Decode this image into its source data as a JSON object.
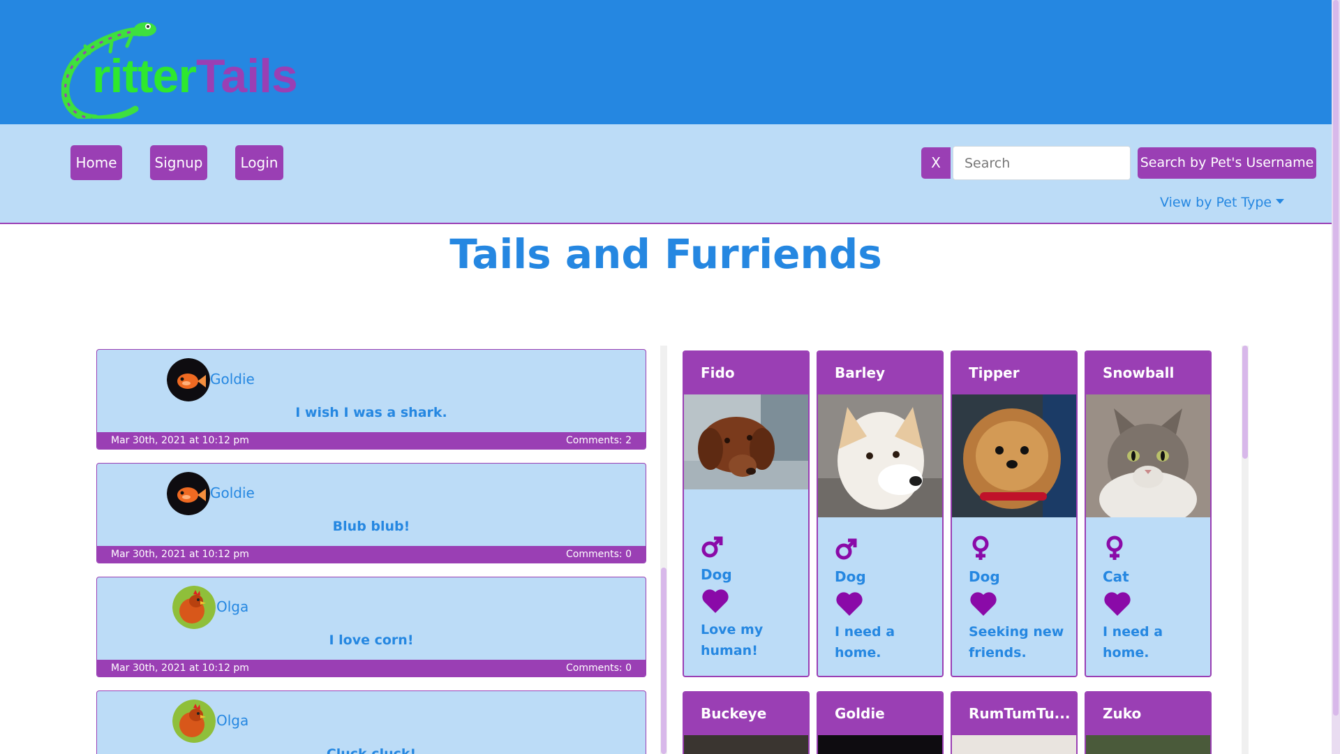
{
  "logo": {
    "part1": "ritter",
    "part2": "Tails"
  },
  "nav": {
    "home": "Home",
    "signup": "Signup",
    "login": "Login",
    "clear": "X",
    "search_placeholder": "Search",
    "search_button": "Search by Pet's Username",
    "pet_type": "View by Pet Type"
  },
  "main": {
    "title": "Tails and Furriends"
  },
  "posts": [
    {
      "author": "Goldie",
      "message": "I wish I was a shark.",
      "date": "Mar 30th, 2021 at 10:12 pm",
      "comments": "Comments: 2"
    },
    {
      "author": "Goldie",
      "message": "Blub blub!",
      "date": "Mar 30th, 2021 at 10:12 pm",
      "comments": "Comments: 0"
    },
    {
      "author": "Olga",
      "message": "I love corn!",
      "date": "Mar 30th, 2021 at 10:12 pm",
      "comments": "Comments: 0"
    },
    {
      "author": "Olga",
      "message": "Cluck cluck!"
    }
  ],
  "pets": [
    {
      "name": "Fido",
      "gender": "male",
      "type": "Dog",
      "status": "Love my human!"
    },
    {
      "name": "Barley",
      "gender": "male",
      "type": "Dog",
      "status": "I need a home."
    },
    {
      "name": "Tipper",
      "gender": "female",
      "type": "Dog",
      "status": "Seeking new friends."
    },
    {
      "name": "Snowball",
      "gender": "female",
      "type": "Cat",
      "status": "I need a home."
    },
    {
      "name": "Buckeye"
    },
    {
      "name": "Goldie"
    },
    {
      "name": "RumTumTu..."
    },
    {
      "name": "Zuko"
    }
  ],
  "colors": {
    "header": "#2587e1",
    "nav": "#bcdcf7",
    "accent": "#9a3fb4",
    "heart": "#8a0aa8"
  }
}
